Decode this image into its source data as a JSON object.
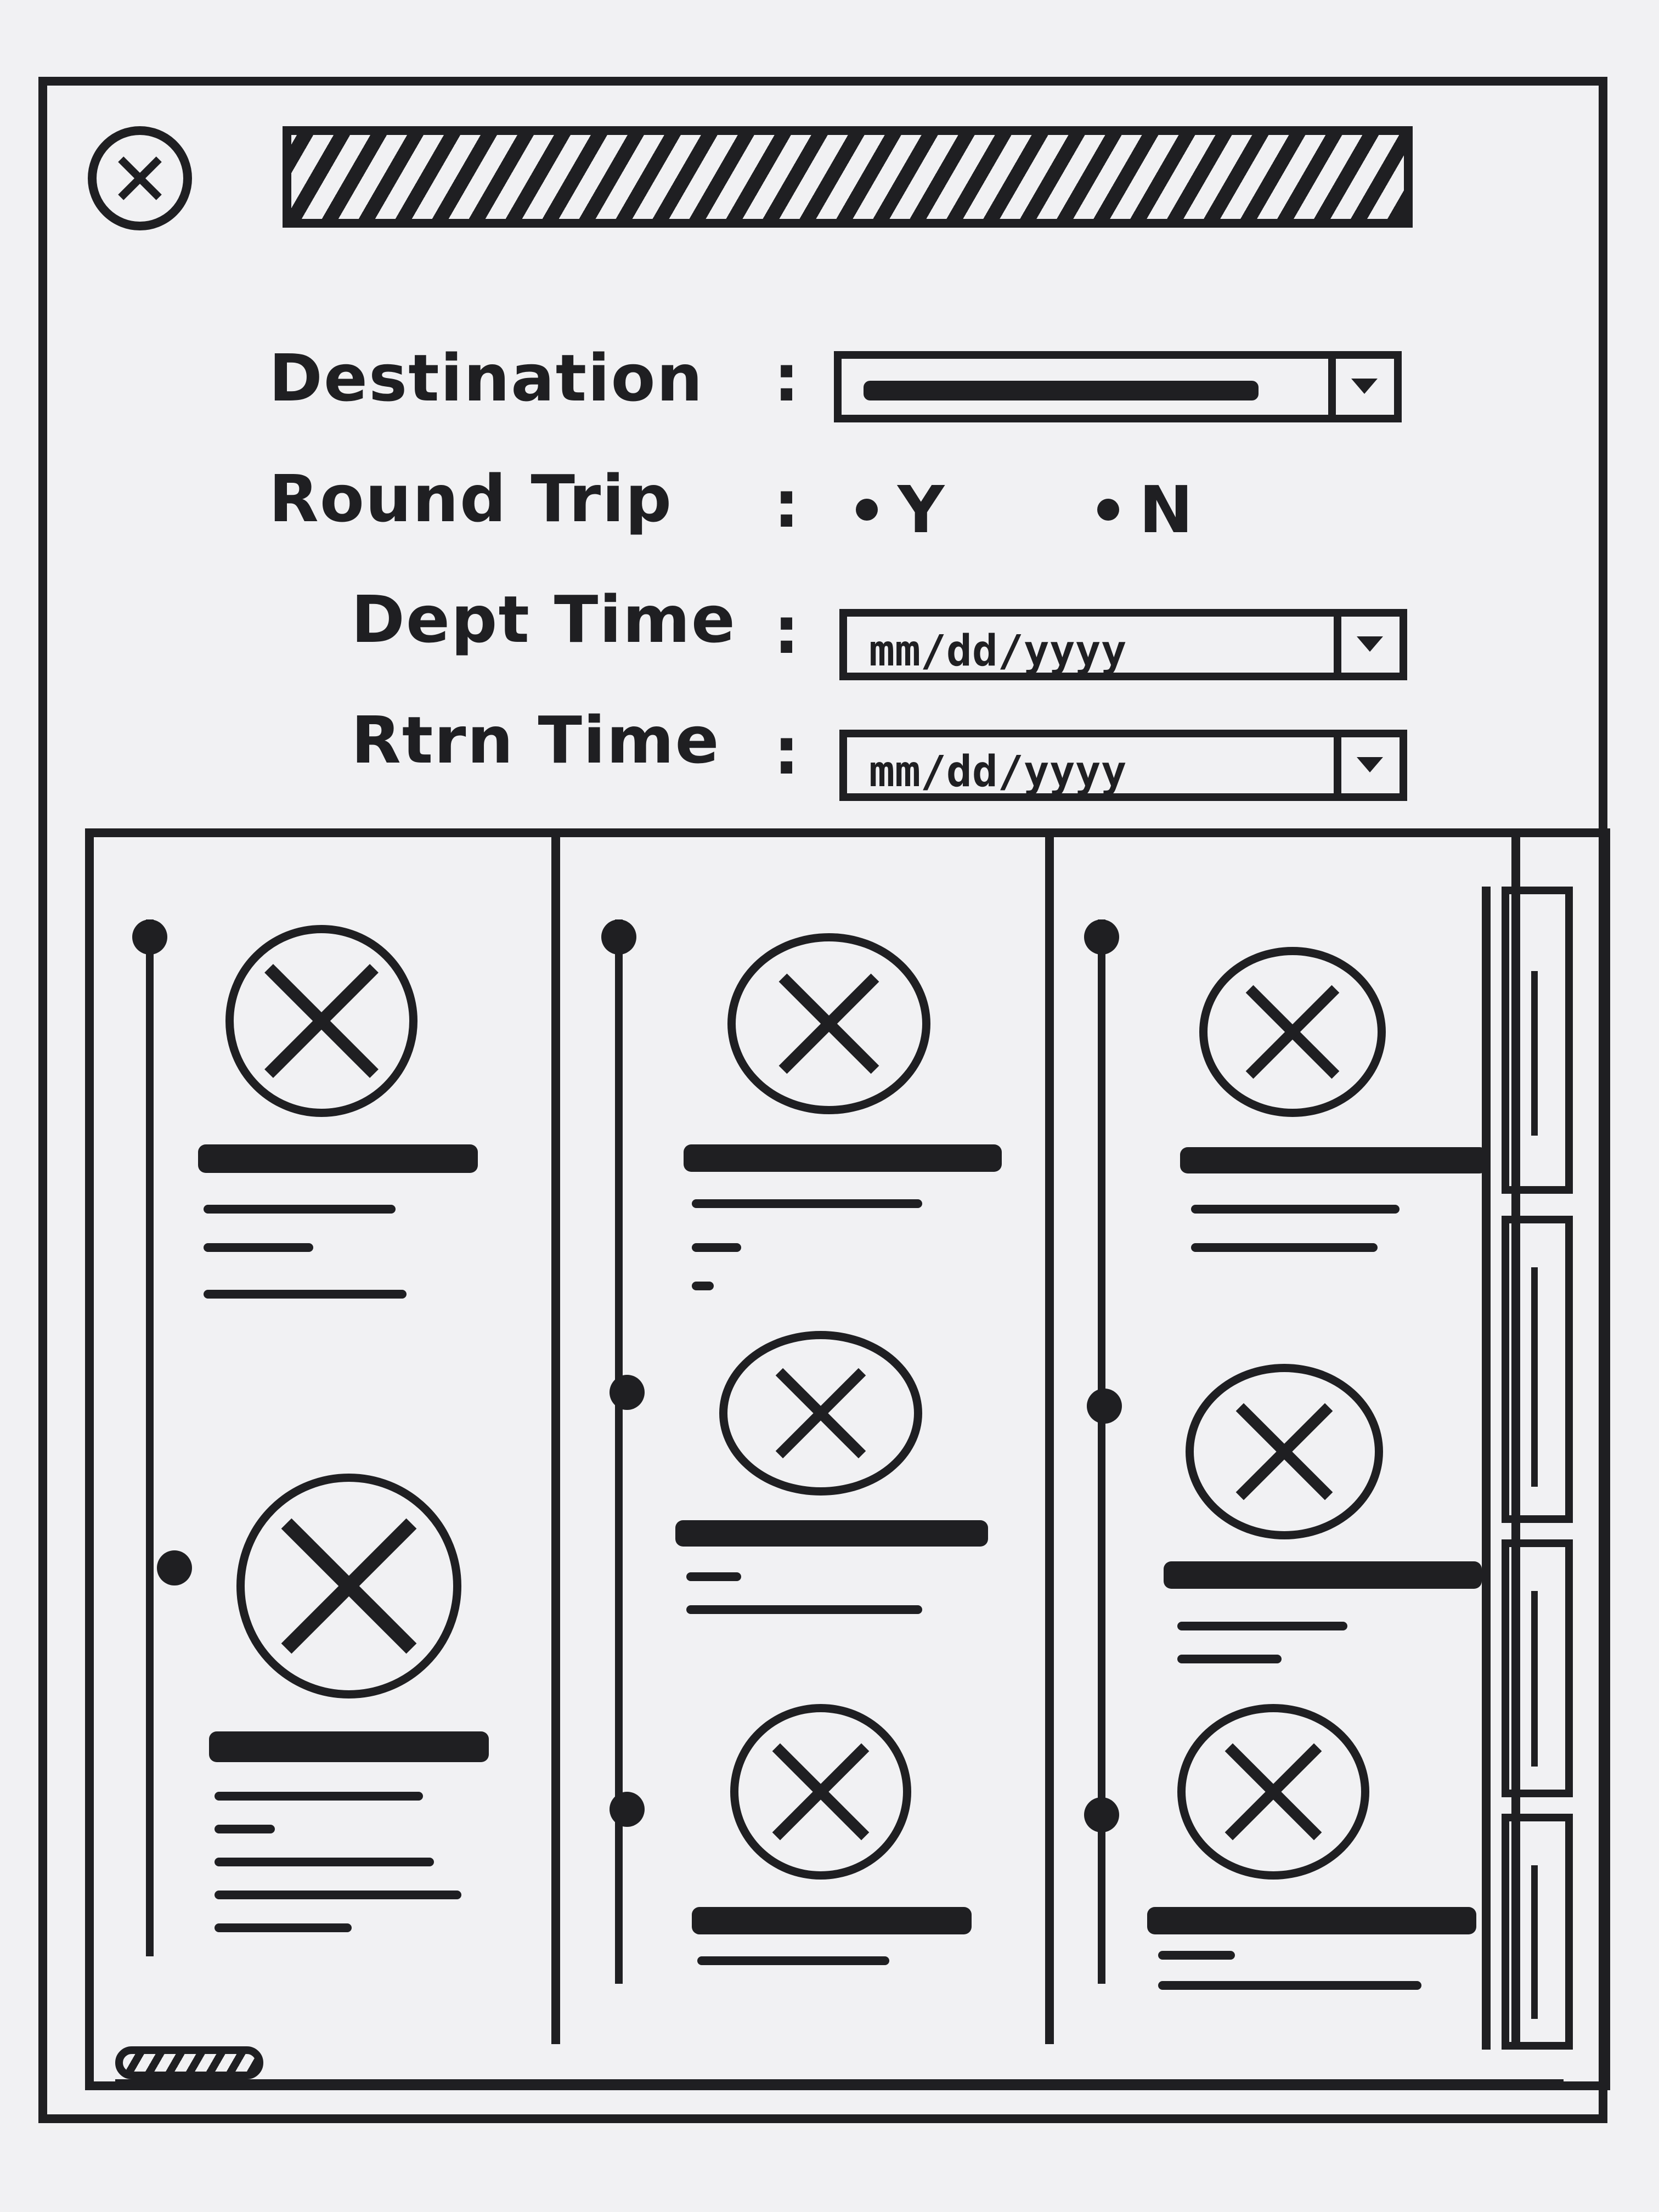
{
  "window": {
    "close_icon": "close-x-circle-icon",
    "title_placeholder": "hatched-title-bar"
  },
  "form": {
    "destination": {
      "label": "Destination",
      "colon": ":",
      "icon": "dropdown-arrow-icon"
    },
    "round_trip": {
      "label": "Round Trip",
      "colon": ":",
      "options": [
        "Y",
        "N"
      ]
    },
    "dept_time": {
      "label": "Dept Time",
      "colon": ":",
      "placeholder": "mm/dd/yyyy",
      "icon": "dropdown-arrow-icon"
    },
    "rtrn_time": {
      "label": "Rtrn Time",
      "colon": ":",
      "placeholder": "mm/dd/yyyy",
      "icon": "dropdown-arrow-icon"
    }
  },
  "results": {
    "image_icon": "image-placeholder-icon",
    "columns": [
      {
        "cards": 2
      },
      {
        "cards": 3
      },
      {
        "cards": 3
      }
    ],
    "scrollbar_segments": 4
  }
}
